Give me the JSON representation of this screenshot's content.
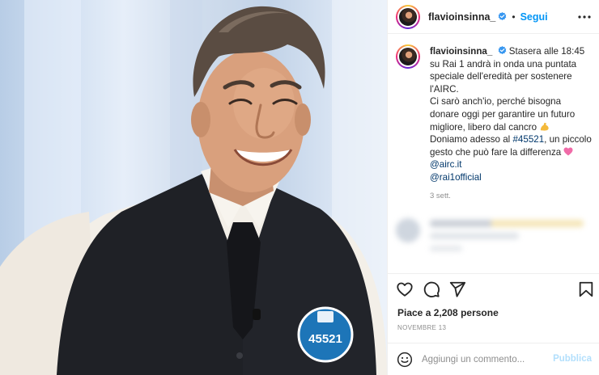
{
  "post": {
    "username": "flavioinsinna_",
    "verified": true,
    "separator": "•",
    "follow_label": "Segui",
    "caption": {
      "username": "flavioinsinna_",
      "p1": "Stasera alle 18:45 su Rai 1 andrà in onda una puntata speciale dell'eredità per sostenere l'AIRC.",
      "p2": "Ci sarò anch'io, perché bisogna donare oggi per garantire un futuro migliore, libero dal cancro",
      "p3_before": "Doniamo adesso al ",
      "p3_hashtag": "#45521",
      "p3_after": ", un piccolo gesto che può fare la differenza",
      "mention1": "@airc.it",
      "mention2": "@rai1official",
      "time_ago": "3 sett."
    },
    "likes_text": "Piace a 2,208 persone",
    "date": "NOVEMBRE 13"
  },
  "photo": {
    "badge_number": "45521"
  },
  "comment_box": {
    "placeholder": "Aggiungi un commento...",
    "publish_label": "Pubblica"
  },
  "icons": {
    "more": "more-options-icon",
    "like": "heart-icon",
    "comment": "comment-icon",
    "share": "share-icon",
    "save": "bookmark-icon",
    "emoji": "emoji-icon",
    "verified": "verified-badge-icon"
  },
  "colors": {
    "accent": "#0095f6",
    "publish_disabled": "#b2dffc",
    "mention": "#00376b",
    "muted": "#8e8e8e"
  }
}
